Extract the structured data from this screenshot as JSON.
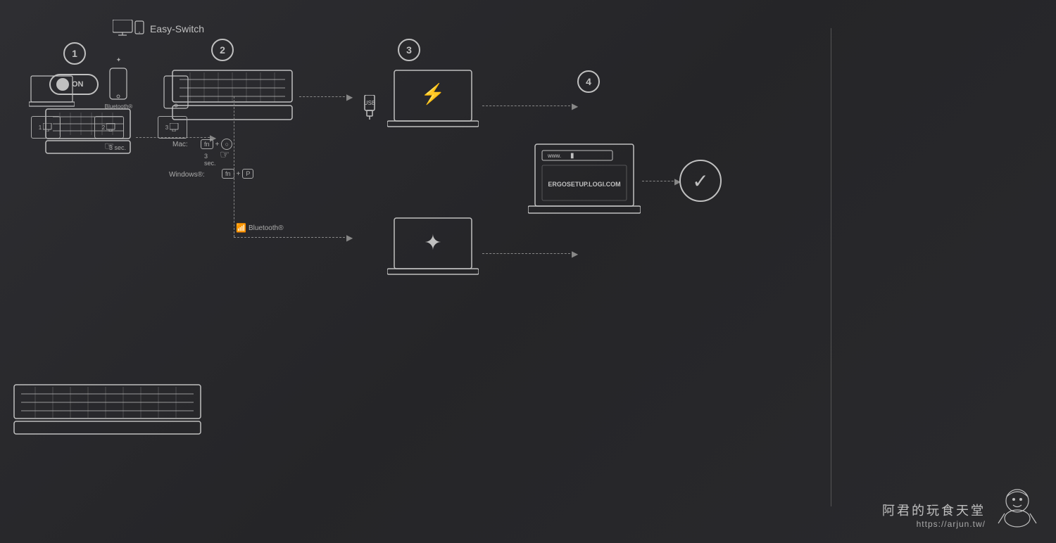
{
  "background_color": "#2a2a2e",
  "steps": [
    {
      "number": "1",
      "label": "step-1",
      "toggle_text": "ON"
    },
    {
      "number": "2",
      "label": "step-2",
      "mac_label": "Mac:",
      "mac_keys": [
        "fn",
        "+",
        "○"
      ],
      "mac_time": "3 sec.",
      "windows_label": "Windows®:",
      "windows_keys": [
        "fn",
        "+",
        "P"
      ]
    },
    {
      "number": "3",
      "label": "step-3",
      "usb_label": "USB",
      "bluetooth_label": "Bluetooth®"
    },
    {
      "number": "4",
      "label": "step-4",
      "website_prefix": "www.",
      "ergo_url": "ERGOSETUP.LOGI.COM"
    }
  ],
  "easy_switch": {
    "title": "Easy-Switch",
    "bluetooth_label": "Bluetooth®",
    "time_label": "3 sec.",
    "buttons": [
      "1",
      "2",
      "3"
    ]
  },
  "watermark": {
    "chinese": "阿君的玩食天堂",
    "url": "https://arjun.tw/"
  }
}
